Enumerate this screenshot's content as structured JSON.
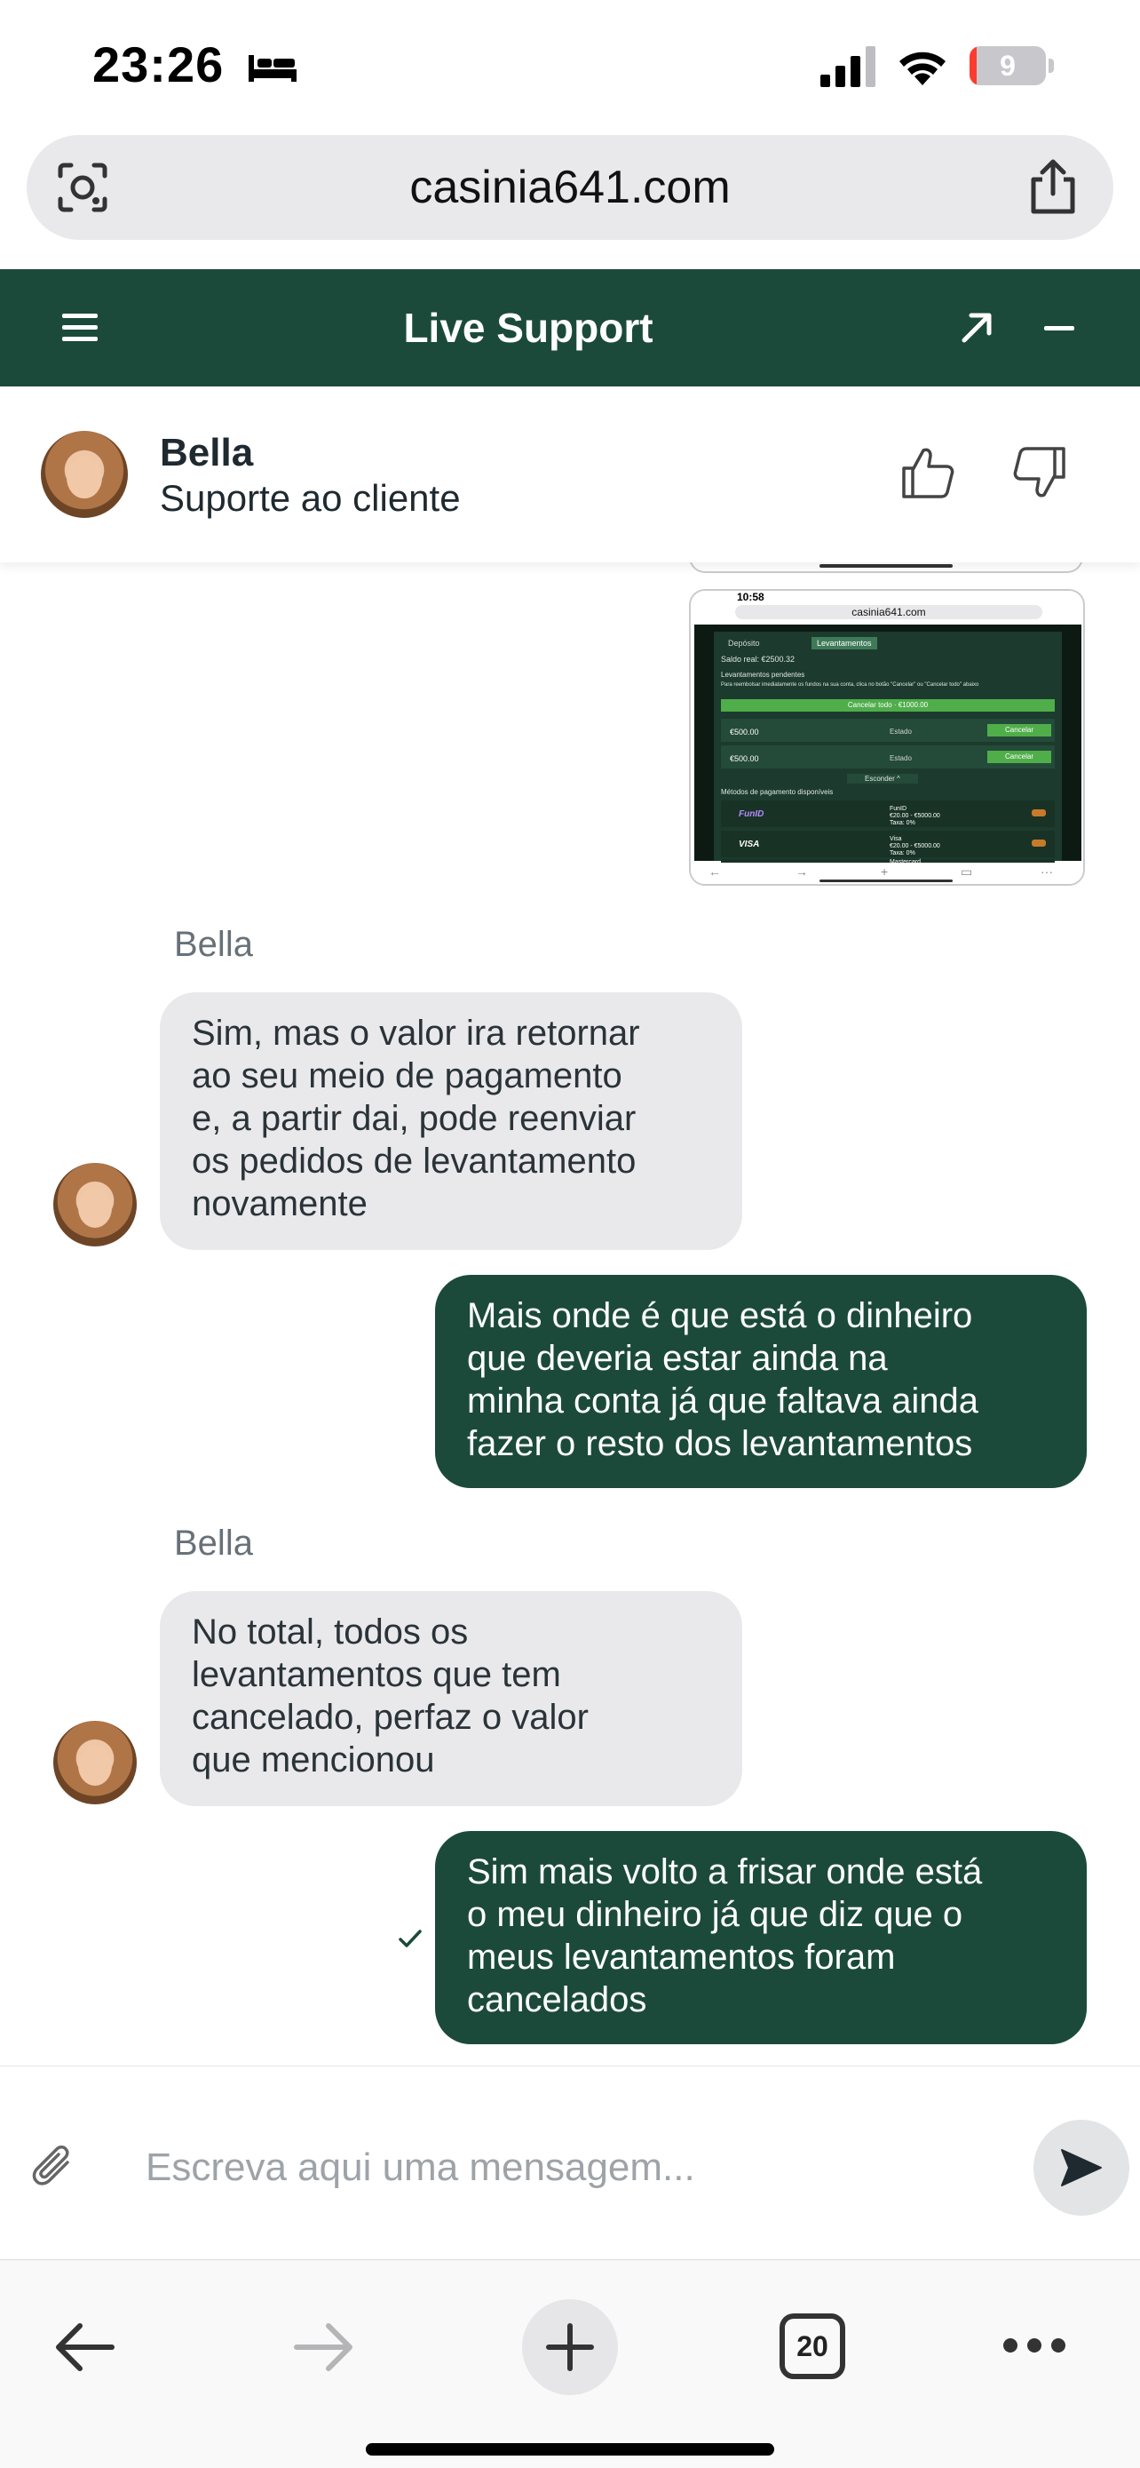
{
  "status_bar": {
    "time": "23:26",
    "battery_level": "9",
    "battery_fraction": 0.09
  },
  "browser": {
    "url": "casinia641.com"
  },
  "header": {
    "title": "Live Support"
  },
  "agent": {
    "name": "Bella",
    "role": "Suporte ao cliente"
  },
  "attachment": {
    "time": "10:58",
    "url": "casinia641.com",
    "tab_deposit": "Depósito",
    "tab_withdraw": "Levantamentos",
    "balance": "Saldo real:  €2500.32",
    "pending_title": "Levantamentos pendentes",
    "notice": "Para reembolsar imediatamente os fundos na sua conta, clica no botão \"Cancelar\" ou \"Cancelar todo\" abaixo",
    "cancel_all": "Cancelar todo · €1000.00",
    "rows": [
      {
        "amount": "€500.00",
        "state": "Estado",
        "button": "Cancelar"
      },
      {
        "amount": "€500.00",
        "state": "Estado",
        "button": "Cancelar"
      }
    ],
    "collapse": "Esconder ^",
    "methods_title": "Métodos de pagamento disponíveis",
    "methods": [
      {
        "name": "FunID",
        "detail": "FunID\n€20.00 - €5000.00\nTaxa: 0%"
      },
      {
        "name": "VISA",
        "detail": "Visa\n€20.00 - €5000.00\nTaxa: 0%"
      },
      {
        "name": "",
        "detail": "Mastercard"
      }
    ]
  },
  "messages": [
    {
      "sender": "Bella",
      "text": "Sim, mas o valor ira retornar\nao seu meio de pagamento\ne, a partir dai, pode reenviar\nos pedidos de levantamento\nnovamente"
    },
    {
      "sender": "",
      "text": "Mais onde é que está o dinheiro\nque deveria estar ainda na\nminha conta já que faltava ainda\nfazer o resto dos levantamentos"
    },
    {
      "sender": "Bella",
      "text": "No total, todos os\nlevantamentos que tem\ncancelado, perfaz o valor\nque mencionou"
    },
    {
      "sender": "",
      "text": "Sim mais volto a frisar onde está\no meu dinheiro já que diz que o\nmeus levantamentos foram\ncancelados"
    }
  ],
  "composer": {
    "placeholder": "Escreva aqui uma mensagem..."
  },
  "toolbar": {
    "tabs_count": "20"
  },
  "colors": {
    "brand": "#1b4a3b",
    "incoming_bubble": "#e9e9ec",
    "battery_low": "#ff3b30"
  },
  "icons": [
    "bed-icon",
    "signal-icon",
    "wifi-icon",
    "lens-icon",
    "share-icon",
    "menu-icon",
    "expand-icon",
    "minimize-icon",
    "thumb-up-icon",
    "thumb-down-icon",
    "check-icon",
    "paperclip-icon",
    "send-icon",
    "back-icon",
    "forward-icon",
    "plus-icon",
    "more-icon"
  ]
}
